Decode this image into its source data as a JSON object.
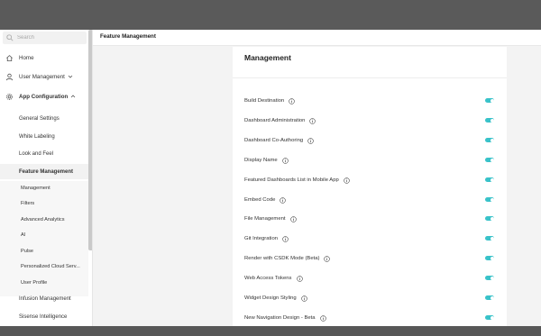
{
  "search": {
    "placeholder": "Search"
  },
  "sidebar": {
    "home": "Home",
    "user_management": "User Management",
    "app_configuration": "App Configuration",
    "sub_items": {
      "general_settings": "General Settings",
      "white_labeling": "White Labeling",
      "look_and_feel": "Look and Feel",
      "feature_management": "Feature Management",
      "infusion_management": "Infusion Management",
      "sisense_intelligence": "Sisense Intelligence"
    },
    "feature_children": [
      "Management",
      "Filters",
      "Advanced Analytics",
      "AI",
      "Pulse",
      "Personalized Cloud Serv...",
      "User Profile"
    ]
  },
  "header": {
    "title": "Feature Management"
  },
  "card": {
    "title": "Management",
    "features": [
      {
        "label": "Build Destination",
        "enabled": true
      },
      {
        "label": "Dashboard Administration",
        "enabled": true
      },
      {
        "label": "Dashboard Co-Authoring",
        "enabled": true
      },
      {
        "label": "Display Name",
        "enabled": true
      },
      {
        "label": "Featured Dashboards List in Mobile App",
        "enabled": true
      },
      {
        "label": "Embed Code",
        "enabled": true
      },
      {
        "label": "File Management",
        "enabled": true
      },
      {
        "label": "Git Integration",
        "enabled": true
      },
      {
        "label": "Render with CSDK Mode (Beta)",
        "enabled": true
      },
      {
        "label": "Web Access Tokens",
        "enabled": true
      },
      {
        "label": "Widget Design Styling",
        "enabled": true
      },
      {
        "label": "New Navigation Design - Beta",
        "enabled": true
      }
    ]
  },
  "colors": {
    "toggle_on": "#39c2c9",
    "background": "#f3f3f3"
  },
  "icons": {
    "search": "search-icon",
    "home": "home-icon",
    "user": "user-icon",
    "gear": "gear-icon",
    "info": "info-icon"
  }
}
